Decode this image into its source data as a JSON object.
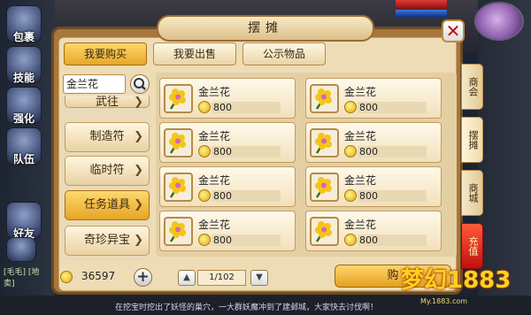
{
  "window_title": "摆摊",
  "close_icon": "close-icon",
  "tabs": [
    {
      "label": "我要购买",
      "active": true
    },
    {
      "label": "我要出售",
      "active": false
    },
    {
      "label": "公示物品",
      "active": false
    }
  ],
  "search": {
    "value": "金兰花",
    "icon": "search-icon"
  },
  "categories": [
    {
      "label": "武往",
      "selected": false
    },
    {
      "label": "制造符",
      "selected": false
    },
    {
      "label": "临时符",
      "selected": false
    },
    {
      "label": "任务道具",
      "selected": true
    },
    {
      "label": "奇珍异宝",
      "selected": false
    }
  ],
  "items": [
    {
      "name": "金兰花",
      "price": "800"
    },
    {
      "name": "金兰花",
      "price": "800"
    },
    {
      "name": "金兰花",
      "price": "800"
    },
    {
      "name": "金兰花",
      "price": "800"
    },
    {
      "name": "金兰花",
      "price": "800"
    },
    {
      "name": "金兰花",
      "price": "800"
    },
    {
      "name": "金兰花",
      "price": "800"
    },
    {
      "name": "金兰花",
      "price": "800"
    }
  ],
  "side_tabs": [
    {
      "label": "商会"
    },
    {
      "label": "摆摊"
    },
    {
      "label": "商城"
    },
    {
      "label": "充值"
    }
  ],
  "gold": "36597",
  "pagination": {
    "page": "1/102",
    "prev_icon": "up-arrow-icon",
    "next_icon": "down-arrow-icon"
  },
  "buy_button": "购",
  "left_menu": [
    {
      "label": "包裹"
    },
    {
      "label": "技能"
    },
    {
      "label": "强化"
    },
    {
      "label": "队伍"
    },
    {
      "label": "好友"
    }
  ],
  "marquee": "在挖宝时挖出了妖怪的巢穴，一大群妖魔冲到了建邺城，大家快去讨伐啊！",
  "chat": "[毛毛] [地卖]",
  "watermark": {
    "logo": "梦幻1883",
    "url": "My.1883.com"
  },
  "colors": {
    "accent": "#e7a727",
    "frame": "#a7773c",
    "panel": "#eedcb6"
  }
}
